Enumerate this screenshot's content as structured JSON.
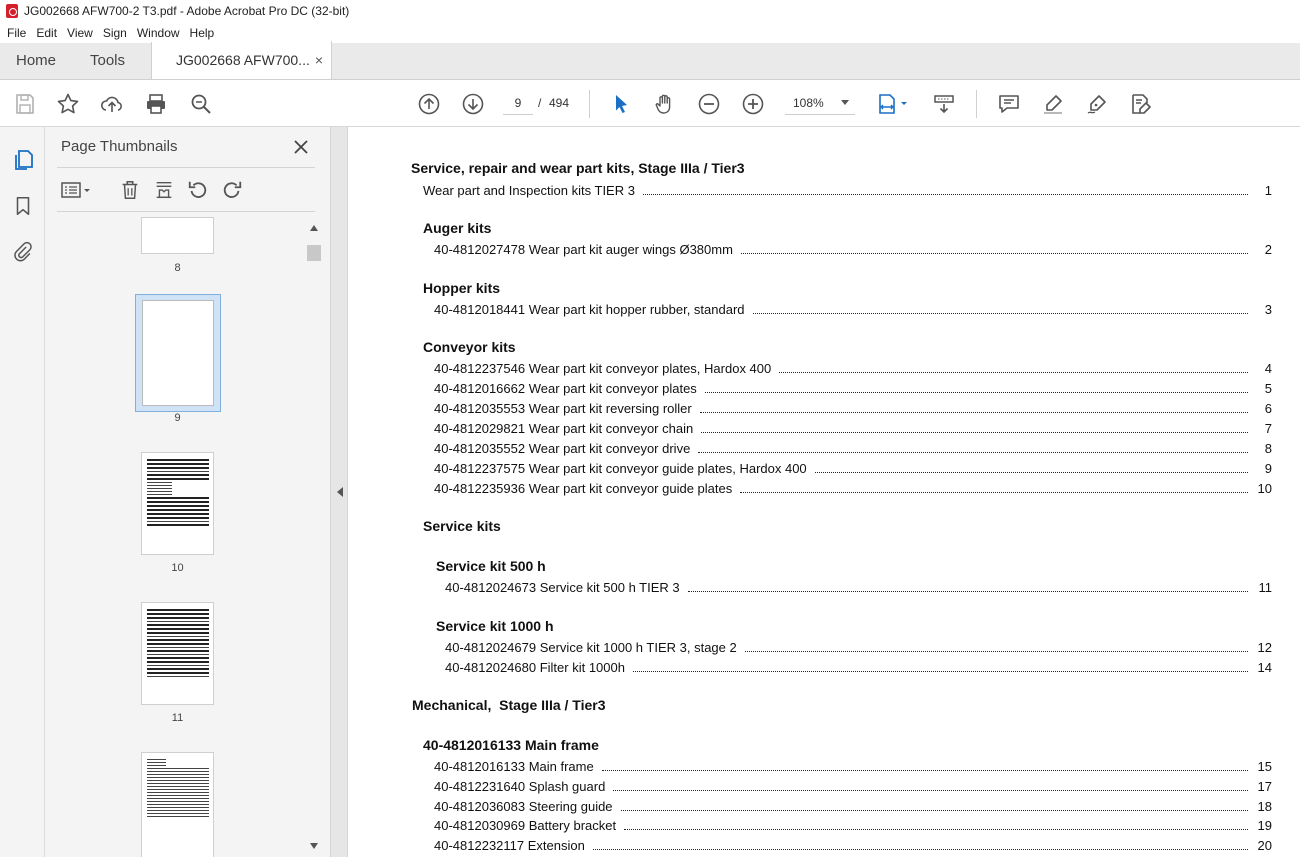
{
  "window": {
    "title": "JG002668 AFW700-2 T3.pdf - Adobe Acrobat Pro DC (32-bit)"
  },
  "menu": [
    "File",
    "Edit",
    "View",
    "Sign",
    "Window",
    "Help"
  ],
  "tabs": {
    "home": "Home",
    "tools": "Tools",
    "document": "JG002668 AFW700...",
    "close": "×"
  },
  "toolbar": {
    "page_current": "9",
    "page_separator": "/",
    "page_total": "494",
    "zoom": "108%"
  },
  "panel": {
    "title": "Page Thumbnails",
    "thumbnails": [
      "8",
      "9",
      "10",
      "11"
    ],
    "selected": "9"
  },
  "toc": {
    "section1": "Service, repair and wear part kits, Stage IIIa / Tier3",
    "section1_items": [
      {
        "text": "Wear part and Inspection kits TIER 3",
        "page": "1"
      }
    ],
    "auger": "Auger kits",
    "auger_items": [
      {
        "text": "40-4812027478 Wear part kit auger wings Ø380mm",
        "page": "2"
      }
    ],
    "hopper": "Hopper kits",
    "hopper_items": [
      {
        "text": "40-4812018441 Wear part kit hopper rubber, standard",
        "page": "3"
      }
    ],
    "conveyor": "Conveyor kits",
    "conveyor_items": [
      {
        "text": "40-4812237546 Wear part kit conveyor plates, Hardox 400",
        "page": "4"
      },
      {
        "text": "40-4812016662 Wear part kit conveyor plates",
        "page": "5"
      },
      {
        "text": "40-4812035553 Wear part kit reversing roller",
        "page": "6"
      },
      {
        "text": "40-4812029821 Wear part kit conveyor chain",
        "page": "7"
      },
      {
        "text": "40-4812035552 Wear part kit conveyor drive",
        "page": "8"
      },
      {
        "text": "40-4812237575 Wear part kit conveyor guide plates, Hardox 400",
        "page": "9"
      },
      {
        "text": "40-4812235936 Wear part kit conveyor guide plates",
        "page": "10"
      }
    ],
    "service": "Service kits",
    "service500": "Service kit 500 h",
    "service500_items": [
      {
        "text": "40-4812024673 Service kit 500 h TIER 3",
        "page": "11"
      }
    ],
    "service1000": "Service kit 1000 h",
    "service1000_items": [
      {
        "text": "40-4812024679 Service kit 1000 h TIER 3, stage 2",
        "page": "12"
      },
      {
        "text": "40-4812024680 Filter kit 1000h",
        "page": "14"
      }
    ],
    "mechanical": "Mechanical,  Stage IIIa / Tier3",
    "mainframe": "40-4812016133 Main frame",
    "mainframe_items": [
      {
        "text": "40-4812016133 Main frame",
        "page": "15"
      },
      {
        "text": "40-4812231640 Splash guard",
        "page": "17"
      },
      {
        "text": "40-4812036083 Steering guide",
        "page": "18"
      },
      {
        "text": "40-4812030969 Battery bracket",
        "page": "19"
      },
      {
        "text": "40-4812232117 Extension",
        "page": "20"
      }
    ]
  }
}
